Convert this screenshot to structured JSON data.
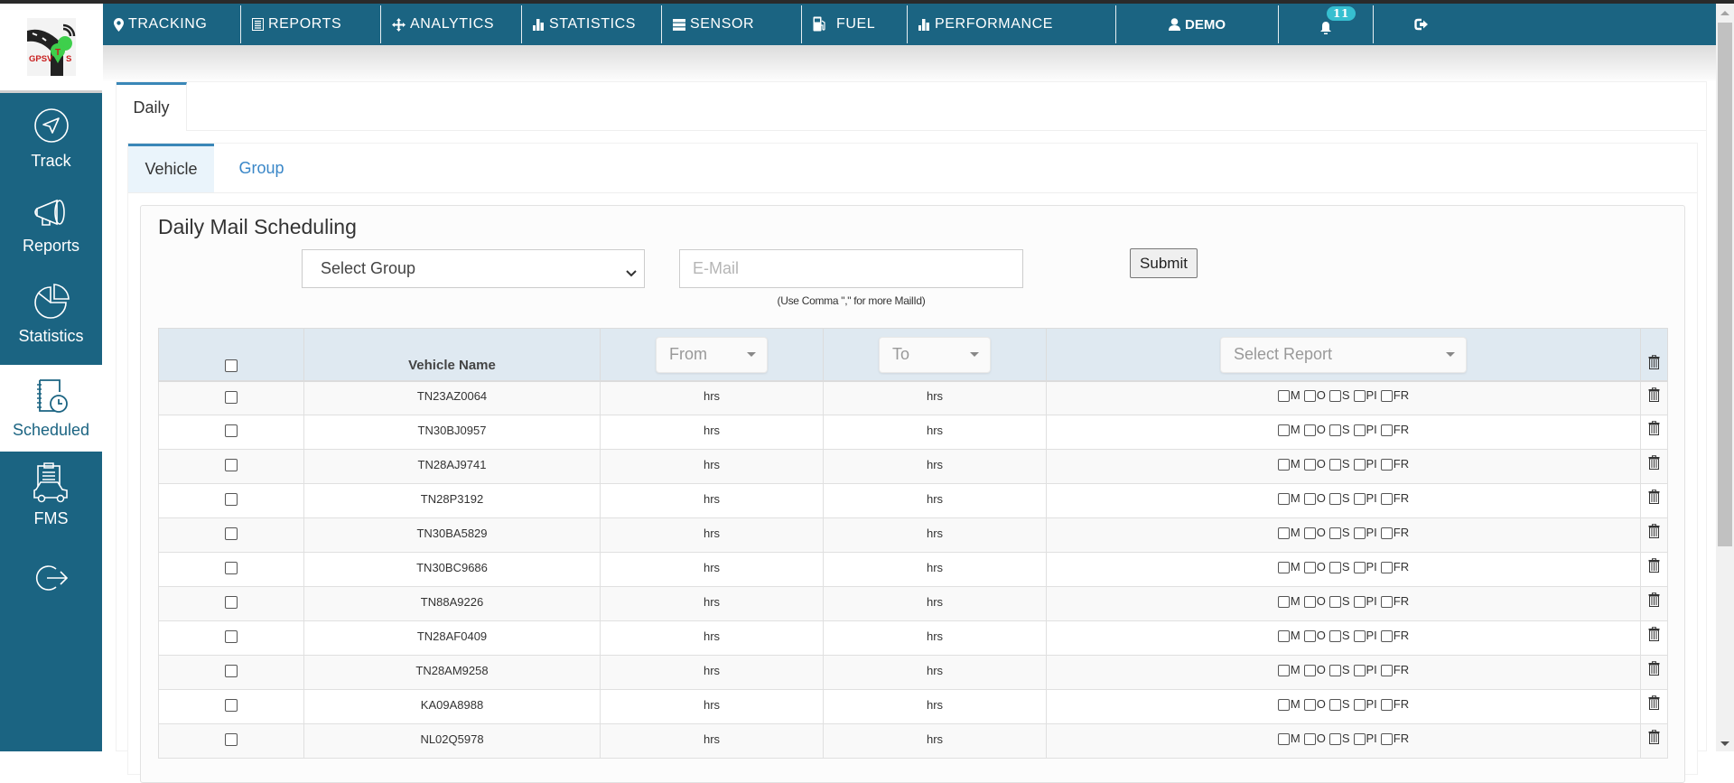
{
  "brand": {
    "logo_text": "GPSVTS",
    "accent": "#1b6482",
    "link_color": "#3a87c8",
    "tab_accent": "#3a87b8"
  },
  "nav": {
    "items": [
      {
        "label": "TRACKING",
        "icon": "map-marker-icon"
      },
      {
        "label": "REPORTS",
        "icon": "list-icon"
      },
      {
        "label": "ANALYTICS",
        "icon": "move-icon"
      },
      {
        "label": "STATISTICS",
        "icon": "bar-chart-icon"
      },
      {
        "label": "SENSOR",
        "icon": "th-list-icon"
      },
      {
        "label": "FUEL",
        "icon": "fuel-pump-icon"
      },
      {
        "label": "PERFORMANCE",
        "icon": "bar-chart-icon"
      }
    ],
    "user": "DEMO",
    "notifications": "11"
  },
  "sidebar": {
    "items": [
      {
        "label": "Track",
        "icon": "navigation-arrow-icon"
      },
      {
        "label": "Reports",
        "icon": "megaphone-icon"
      },
      {
        "label": "Statistics",
        "icon": "pie-chart-icon"
      },
      {
        "label": "Scheduled",
        "icon": "schedule-clock-icon",
        "active": true
      },
      {
        "label": "FMS",
        "icon": "fleet-car-icon"
      },
      {
        "label": "",
        "icon": "logout-icon"
      }
    ]
  },
  "tabs": {
    "outer": [
      "Daily"
    ],
    "inner": [
      "Vehicle",
      "Group"
    ],
    "active_inner": "Vehicle"
  },
  "form": {
    "title": "Daily Mail Scheduling",
    "group_select": "Select Group",
    "email_placeholder": "E-Mail",
    "email_value": "",
    "hint": "(Use Comma \",\" for more MailId)",
    "submit_label": "Submit"
  },
  "table": {
    "headers": {
      "vehicle": "Vehicle Name",
      "from": "From",
      "to": "To",
      "report": "Select Report"
    },
    "report_options": [
      "M",
      "O",
      "S",
      "PI",
      "FR"
    ],
    "rows": [
      {
        "vehicle": "TN23AZ0064",
        "from": "hrs",
        "to": "hrs"
      },
      {
        "vehicle": "TN30BJ0957",
        "from": "hrs",
        "to": "hrs"
      },
      {
        "vehicle": "TN28AJ9741",
        "from": "hrs",
        "to": "hrs"
      },
      {
        "vehicle": "TN28P3192",
        "from": "hrs",
        "to": "hrs"
      },
      {
        "vehicle": "TN30BA5829",
        "from": "hrs",
        "to": "hrs"
      },
      {
        "vehicle": "TN30BC9686",
        "from": "hrs",
        "to": "hrs"
      },
      {
        "vehicle": "TN88A9226",
        "from": "hrs",
        "to": "hrs"
      },
      {
        "vehicle": "TN28AF0409",
        "from": "hrs",
        "to": "hrs"
      },
      {
        "vehicle": "TN28AM9258",
        "from": "hrs",
        "to": "hrs"
      },
      {
        "vehicle": "KA09A8988",
        "from": "hrs",
        "to": "hrs"
      },
      {
        "vehicle": "NL02Q5978",
        "from": "hrs",
        "to": "hrs"
      }
    ]
  }
}
